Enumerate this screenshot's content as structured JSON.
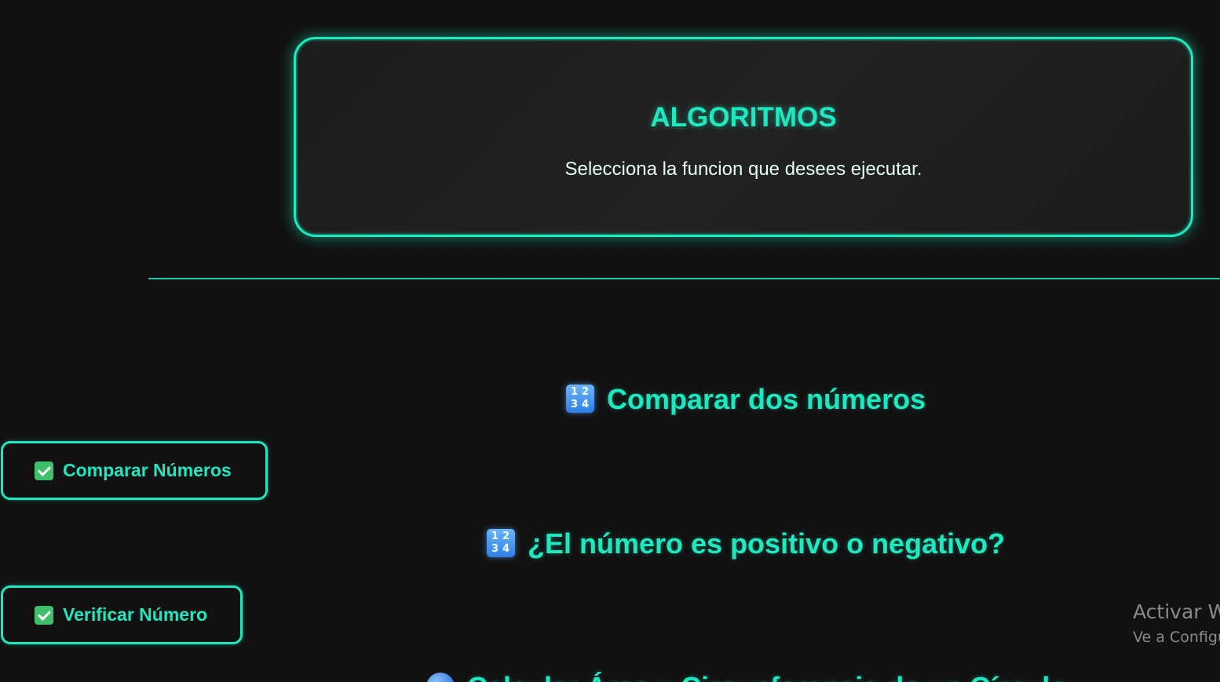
{
  "header": {
    "title": "ALGORITMOS",
    "subtitle": "Selecciona la funcion que desees ejecutar."
  },
  "sections": [
    {
      "title": "Comparar dos números",
      "icon": "input-numbers-icon",
      "button_label": "Comparar Números",
      "button_icon": "check-mark-button-icon"
    },
    {
      "title": "¿El número es positivo o negativo?",
      "icon": "input-numbers-icon",
      "button_label": "Verificar Número",
      "button_icon": "check-mark-button-icon"
    },
    {
      "title": "Calcular Área y Circunferencia de un Círculo",
      "icon": "globe-icon"
    }
  ],
  "watermark": {
    "title": "Activar Windows",
    "subtitle": "Ve a Configuración para activar Windows."
  },
  "colors": {
    "accent": "#1de9c0",
    "background": "#111111",
    "card": "#1e1e1e"
  }
}
